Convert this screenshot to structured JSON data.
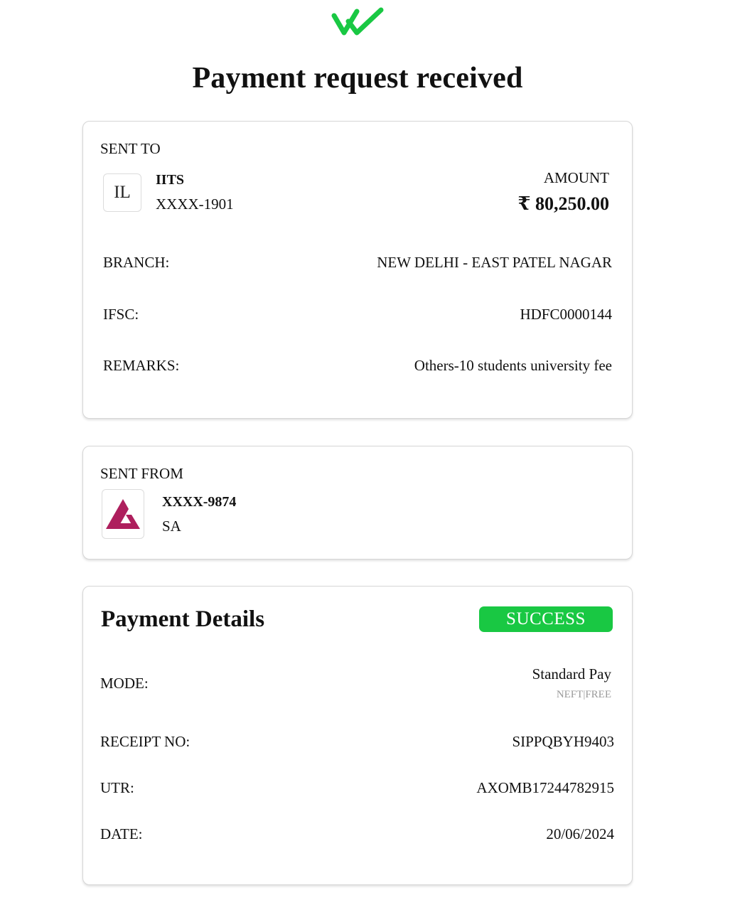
{
  "header": {
    "title": "Payment request received",
    "icon": "double-check-icon",
    "accent_color": "#19c843"
  },
  "sent_to": {
    "section_label": "SENT TO",
    "avatar_initials": "IL",
    "name": "IITS",
    "account": "XXXX-1901",
    "amount_label": "AMOUNT",
    "amount": "₹ 80,250.00",
    "rows": [
      {
        "label": "BRANCH:",
        "value": "NEW DELHI - EAST PATEL NAGAR"
      },
      {
        "label": "IFSC:",
        "value": "HDFC0000144"
      },
      {
        "label": "REMARKS:",
        "value": "Others-10 students university fee"
      }
    ]
  },
  "sent_from": {
    "section_label": "SENT FROM",
    "bank_icon": "axis-bank-logo",
    "bank_color": "#ae1f5d",
    "account": "XXXX-9874",
    "name": "SA"
  },
  "payment_details": {
    "title": "Payment Details",
    "status": "SUCCESS",
    "status_color": "#19c843",
    "mode_label": "MODE:",
    "mode_value": "Standard Pay",
    "mode_sub": "NEFT|FREE",
    "rows": [
      {
        "label": "RECEIPT NO:",
        "value": "SIPPQBYH9403"
      },
      {
        "label": "UTR:",
        "value": "AXOMB17244782915"
      },
      {
        "label": "DATE:",
        "value": "20/06/2024"
      }
    ]
  }
}
